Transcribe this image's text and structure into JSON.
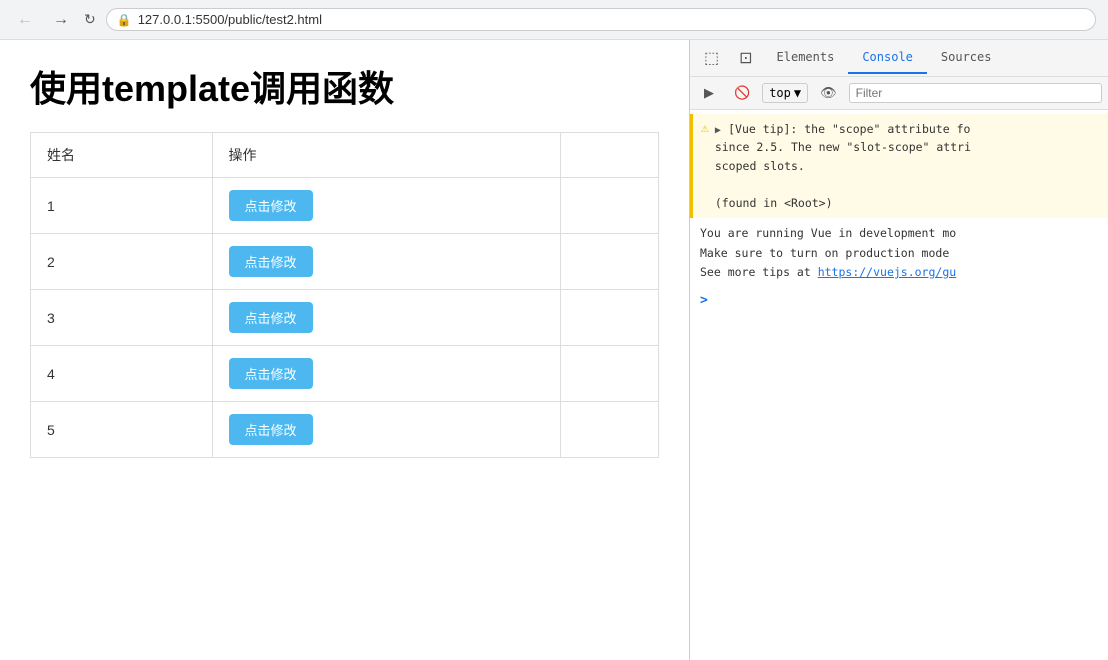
{
  "browser": {
    "url": "127.0.0.1:5500/public/test2.html",
    "back_label": "←",
    "forward_label": "→",
    "refresh_label": "↻"
  },
  "page": {
    "title": "使用template调用函数",
    "table": {
      "col_name": "姓名",
      "col_action": "操作",
      "rows": [
        {
          "id": "1",
          "btn": "点击修改"
        },
        {
          "id": "2",
          "btn": "点击修改"
        },
        {
          "id": "3",
          "btn": "点击修改"
        },
        {
          "id": "4",
          "btn": "点击修改"
        },
        {
          "id": "5",
          "btn": "点击修改"
        }
      ]
    }
  },
  "devtools": {
    "tabs": [
      "Elements",
      "Console",
      "Sources"
    ],
    "active_tab": "Console",
    "top_label": "top",
    "filter_placeholder": "Filter",
    "console": {
      "warning_text": "[Vue tip]: the \"scope\" attribute fo since 2.5. The new \"slot-scope\" attri scoped slots.",
      "warning_line2": "(found in <Root>)",
      "info_line1": "You are running Vue in development mo",
      "info_line2": "Make sure to turn on production mode",
      "info_line3": "See more tips at",
      "info_link": "https://vuejs.org/gu"
    }
  }
}
